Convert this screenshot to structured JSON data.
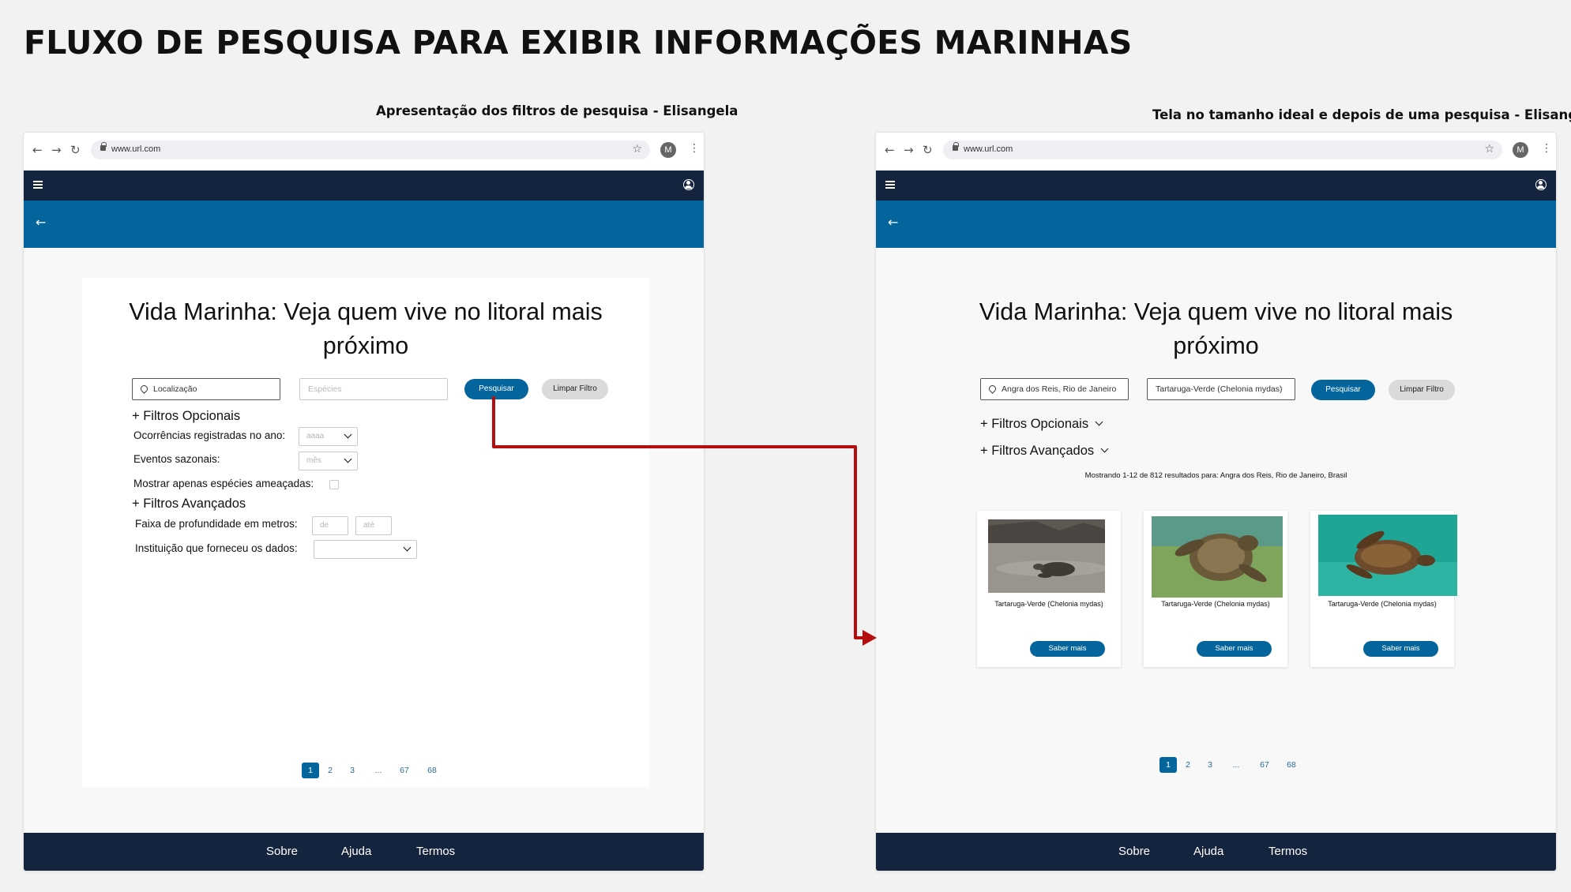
{
  "title": "FLUXO DE PESQUISA PARA EXIBIR INFORMAÇÕES MARINHAS",
  "colors": {
    "nav": "#14243f",
    "header": "#03659c",
    "primary": "#03659c",
    "arrow": "#b50e0e"
  },
  "browser": {
    "url": "www.url.com",
    "profile_initial": "M"
  },
  "footer": {
    "links": [
      "Sobre",
      "Ajuda",
      "Termos"
    ]
  },
  "left": {
    "label": "Apresentação dos filtros de pesquisa - Elisangela",
    "headline_line1": "Vida Marinha: Veja quem vive no litoral mais",
    "headline_line2": "próximo",
    "location_placeholder": "Localização",
    "species_placeholder": "Espécies",
    "search_button": "Pesquisar",
    "clear_button": "Limpar Filtro",
    "optional_filters": "+ Filtros Opcionais",
    "occurrences_label": "Ocorrências registradas no ano:",
    "year_placeholder": "aaaa",
    "seasonal_label": "Eventos sazonais:",
    "month_placeholder": "mês",
    "threatened_label": "Mostrar apenas espécies ameaçadas:",
    "advanced_filters": "+ Filtros Avançados",
    "depth_label": "Faixa de profundidade em metros:",
    "depth_from": "de",
    "depth_to": "até",
    "institution_label": "Instituição que forneceu os dados:",
    "pages": [
      "1",
      "2",
      "3",
      "...",
      "67",
      "68"
    ]
  },
  "right": {
    "label": "Tela no tamanho ideal e depois de uma pesquisa - Elisangela",
    "headline_line1": "Vida Marinha: Veja quem vive no litoral mais",
    "headline_line2": "próximo",
    "location_value": "Angra dos Reis, Rio de Janeiro",
    "species_value": "Tartaruga-Verde (Chelonia mydas)",
    "search_button": "Pesquisar",
    "clear_button": "Limpar Filtro",
    "optional_filters": "+ Filtros Opcionais",
    "advanced_filters": "+ Filtros Avançados",
    "results_summary": "Mostrando 1-12 de 812 resultados para: Angra dos Reis, Rio de Janeiro, Brasil",
    "cards": [
      {
        "name": "Tartaruga-Verde (Chelonia mydas)",
        "button": "Saber mais"
      },
      {
        "name": "Tartaruga-Verde (Chelonia mydas)",
        "button": "Saber mais"
      },
      {
        "name": "Tartaruga-Verde (Chelonia mydas)",
        "button": "Saber mais"
      }
    ],
    "pages": [
      "1",
      "2",
      "3",
      "...",
      "67",
      "68"
    ]
  }
}
